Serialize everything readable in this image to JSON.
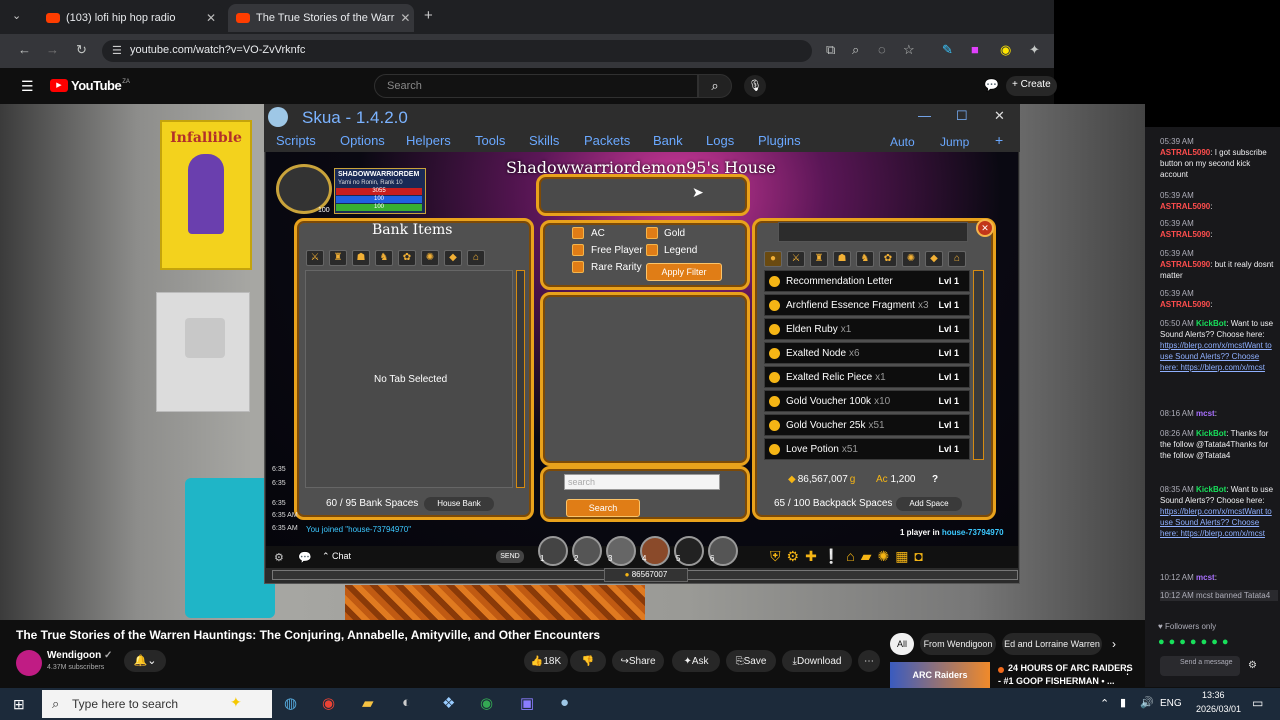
{
  "browser": {
    "tabs": [
      {
        "title": "(103) lofi hip hop radio"
      },
      {
        "title": "The True Stories of the Warr"
      }
    ],
    "url": "youtube.com/watch?v=VO-ZvVrknfc"
  },
  "youtube": {
    "logo": "YouTube",
    "logo_sup": "ZA",
    "search_placeholder": "Search",
    "create_label": "Create",
    "video_title": "The True Stories of the Warren Hauntings: The Conjuring, Annabelle, Amityville, and Other Encounters",
    "channel_name": "Wendigoon",
    "subscribers": "4.37M subscribers",
    "likes": "18K",
    "share_label": "Share",
    "ask_label": "Ask",
    "save_label": "Save",
    "download_label": "Download",
    "chips": [
      "All",
      "From Wendigoon",
      "Ed and Lorraine Warren"
    ],
    "rec_title": "24 HOURS OF ARC RAIDERS",
    "rec_subtitle": "- #1 GOOP FISHERMAN • ...",
    "rec_thumb_text": "ARC Raiders"
  },
  "skua": {
    "title": "Skua - 1.4.2.0",
    "menu": [
      "Scripts",
      "Options",
      "Helpers",
      "Tools",
      "Skills",
      "Packets",
      "Bank",
      "Logs",
      "Plugins"
    ],
    "right_menu": [
      "Auto",
      "Jump"
    ]
  },
  "game": {
    "house_title": "Shadowwarriordemon95's House",
    "player_name": "SHADOWWARRIORDEM",
    "player_class": "Yami no Ronin, Rank 10",
    "hp": "3055",
    "mp": "100",
    "sp": "100",
    "level_badge": "100",
    "bank_title": "Bank Items",
    "no_tab": "No Tab Selected",
    "bank_spaces": "60 / 95 Bank Spaces",
    "house_bank": "House Bank",
    "filters": {
      "ac": "AC",
      "gold": "Gold",
      "free_player": "Free Player",
      "legend": "Legend",
      "rare_rarity": "Rare Rarity",
      "apply": "Apply Filter"
    },
    "search_placeholder": "search",
    "search_button": "Search",
    "inventory": [
      {
        "name": "Recommendation Letter",
        "qty": "",
        "lvl": "Lvl 1"
      },
      {
        "name": "Archfiend Essence Fragment",
        "qty": "x3",
        "lvl": "Lvl 1"
      },
      {
        "name": "Elden Ruby",
        "qty": "x1",
        "lvl": "Lvl 1"
      },
      {
        "name": "Exalted Node",
        "qty": "x6",
        "lvl": "Lvl 1"
      },
      {
        "name": "Exalted Relic Piece",
        "qty": "x1",
        "lvl": "Lvl 1"
      },
      {
        "name": "Gold Voucher 100k",
        "qty": "x10",
        "lvl": "Lvl 1"
      },
      {
        "name": "Gold Voucher 25k",
        "qty": "x51",
        "lvl": "Lvl 1"
      },
      {
        "name": "Love Potion",
        "qty": "x51",
        "lvl": "Lvl 1"
      }
    ],
    "gold_amount": "86,567,007",
    "gold_suffix": "g",
    "ac_amount": "1,200",
    "help": "?",
    "backpack_spaces": "65 / 100 Backpack Spaces",
    "add_space": "Add Space",
    "joined_msg": "You joined \"house-73794970\"",
    "players_in": "1 player in",
    "house_id": "house-73794970",
    "chat_label": "Chat",
    "send_label": "SEND",
    "xp_label": "86567007",
    "hotbar": [
      "1",
      "2",
      "3",
      "4",
      "5",
      "6"
    ],
    "timestamps": [
      "6:35",
      "6:35",
      "6:35",
      "6:35 AM",
      "6:35 AM"
    ]
  },
  "chat": {
    "lines": [
      {
        "t": "05:39 AM",
        "user": "ASTRAL5090",
        "msg": ": I got subscribe button on my second kick account"
      },
      {
        "t": "05:39 AM",
        "user": "ASTRAL5090",
        "msg": ":"
      },
      {
        "t": "05:39 AM",
        "user": "ASTRAL5090",
        "msg": ":"
      },
      {
        "t": "05:39 AM",
        "user": "ASTRAL5090",
        "msg": ": but it realy dosnt matter"
      },
      {
        "t": "05:39 AM",
        "user": "ASTRAL5090",
        "msg": ":"
      },
      {
        "t": "05:50 AM",
        "user": "KickBot",
        "msg": ": Want to use Sound Alerts?? Choose here:"
      },
      {
        "t": "",
        "user": "",
        "msg": "https://blerp.com/x/mcstWant to use Sound Alerts?? Choose here: https://blerp.com/x/mcst"
      },
      {
        "t": "08:16 AM",
        "user": "mcst",
        "msg": ":"
      },
      {
        "t": "08:26 AM",
        "user": "KickBot",
        "msg": ": Thanks for the follow @Tatata4Thanks for the follow @Tatata4"
      },
      {
        "t": "08:35 AM",
        "user": "KickBot",
        "msg": ": Want to use Sound Alerts?? Choose here:"
      },
      {
        "t": "",
        "user": "",
        "msg": "https://blerp.com/x/mcstWant to use Sound Alerts?? Choose here: https://blerp.com/x/mcst"
      },
      {
        "t": "10:12 AM",
        "user": "mcst",
        "msg": ":"
      },
      {
        "t": "10:12 AM",
        "user": "",
        "msg": "mcst banned Tatata4"
      }
    ],
    "followers_only": "Followers only",
    "send_label": "Send a message"
  },
  "taskbar": {
    "search_placeholder": "Type here to search",
    "lang": "ENG",
    "time": "13:36",
    "date": "2026/03/01"
  }
}
